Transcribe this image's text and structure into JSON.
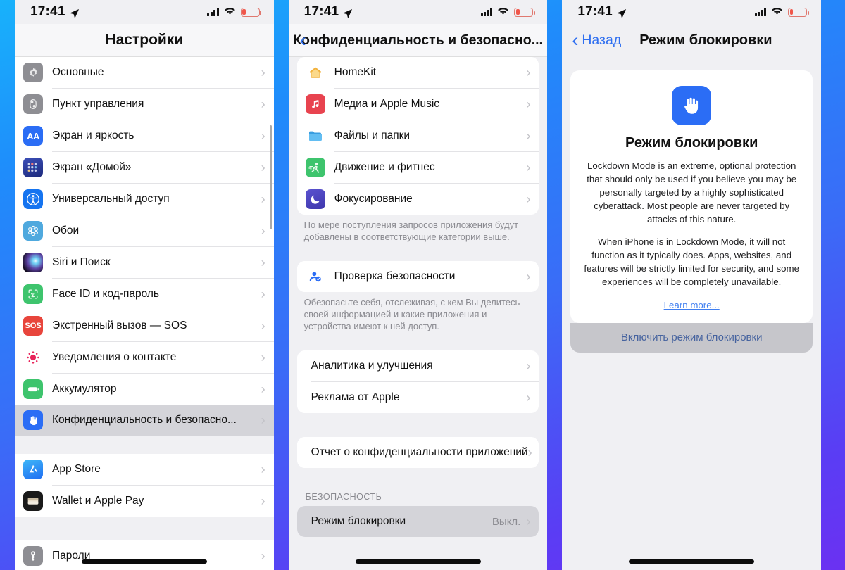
{
  "statusbar": {
    "time": "17:41",
    "location_icon": "location-arrow-icon",
    "signal_icon": "cellular-bars-icon",
    "wifi_icon": "wifi-icon",
    "battery_icon": "battery-low-icon"
  },
  "colors": {
    "accent_blue": "#2b6df5",
    "link_blue": "#3f7ef0",
    "selected_row": "#d4d4d9",
    "page_bg": "#f0f0f3",
    "card_bg": "#ffffff",
    "separator": "#e3e3e6",
    "footnote_text": "#8a8a90"
  },
  "panel1": {
    "title": "Настройки",
    "groups": [
      {
        "rows": [
          {
            "label": "Основные",
            "icon": "gear-icon",
            "icon_class": "ic-gear"
          },
          {
            "label": "Пункт управления",
            "icon": "control-center-icon",
            "icon_class": "ic-cc"
          },
          {
            "label": "Экран и яркость",
            "icon": "display-brightness-icon",
            "icon_class": "ic-aa"
          },
          {
            "label": "Экран «Домой»",
            "icon": "home-screen-icon",
            "icon_class": "ic-home"
          },
          {
            "label": "Универсальный доступ",
            "icon": "accessibility-icon",
            "icon_class": "ic-access"
          },
          {
            "label": "Обои",
            "icon": "wallpaper-icon",
            "icon_class": "ic-wall"
          },
          {
            "label": "Siri и Поиск",
            "icon": "siri-icon",
            "icon_class": "ic-siri"
          },
          {
            "label": "Face ID и код-пароль",
            "icon": "face-id-icon",
            "icon_class": "ic-face"
          },
          {
            "label": "Экстренный вызов — SOS",
            "icon": "sos-icon",
            "icon_class": "ic-sos"
          },
          {
            "label": "Уведомления о контакте",
            "icon": "contact-notification-icon",
            "icon_class": "ic-contact"
          },
          {
            "label": "Аккумулятор",
            "icon": "battery-icon",
            "icon_class": "ic-batt"
          },
          {
            "label": "Конфиденциальность и безопасно...",
            "icon": "privacy-hand-icon",
            "icon_class": "ic-priv",
            "selected": true
          }
        ]
      },
      {
        "rows": [
          {
            "label": "App Store",
            "icon": "app-store-icon",
            "icon_class": "ic-appstore"
          },
          {
            "label": "Wallet и Apple Pay",
            "icon": "wallet-icon",
            "icon_class": "ic-wallet"
          }
        ]
      },
      {
        "rows": [
          {
            "label": "Пароли",
            "icon": "passwords-key-icon",
            "icon_class": "ic-pass"
          }
        ]
      }
    ]
  },
  "panel2": {
    "title": "Конфиденциальность и безопасно...",
    "back_icon": "back-chevron-icon",
    "group_apps": [
      {
        "label": "HomeKit",
        "icon": "homekit-icon",
        "icon_class": "ic-homekit"
      },
      {
        "label": "Медиа и Apple Music",
        "icon": "apple-music-icon",
        "icon_class": "ic-music"
      },
      {
        "label": "Файлы и папки",
        "icon": "files-folder-icon",
        "icon_class": "ic-files"
      },
      {
        "label": "Движение и фитнес",
        "icon": "fitness-icon",
        "icon_class": "ic-fitness"
      },
      {
        "label": "Фокусирование",
        "icon": "focus-moon-icon",
        "icon_class": "ic-focus"
      }
    ],
    "footnote_apps": "По мере поступления запросов приложения будут добавлены в соответствующие категории выше.",
    "safety_check": {
      "label": "Проверка безопасности",
      "icon": "safety-check-icon",
      "icon_class": "ic-check"
    },
    "footnote_safety": "Обезопасьте себя, отслеживая, с кем Вы делитесь своей информацией и какие приложения и устройства имеют к ней доступ.",
    "group_analytics": [
      {
        "label": "Аналитика и улучшения"
      },
      {
        "label": "Реклама от Apple"
      }
    ],
    "group_report": [
      {
        "label": "Отчет о конфиденциальности приложений"
      }
    ],
    "security_header": "БЕЗОПАСНОСТЬ",
    "lockdown_row": {
      "label": "Режим блокировки",
      "value": "Выкл.",
      "selected": true
    }
  },
  "panel3": {
    "back_label": "Назад",
    "back_icon": "back-chevron-icon",
    "title": "Режим блокировки",
    "card": {
      "icon": "lockdown-hand-icon",
      "heading": "Режим блокировки",
      "paragraph1": "Lockdown Mode is an extreme, optional protection that should only be used if you believe you may be personally targeted by a highly sophisticated cyberattack. Most people are never targeted by attacks of this nature.",
      "paragraph2": "When iPhone is in Lockdown Mode, it will not function as it typically does. Apps, websites, and features will be strictly limited for security, and some experiences will be completely unavailable.",
      "link": "Learn more...",
      "button": "Включить режим блокировки"
    }
  }
}
